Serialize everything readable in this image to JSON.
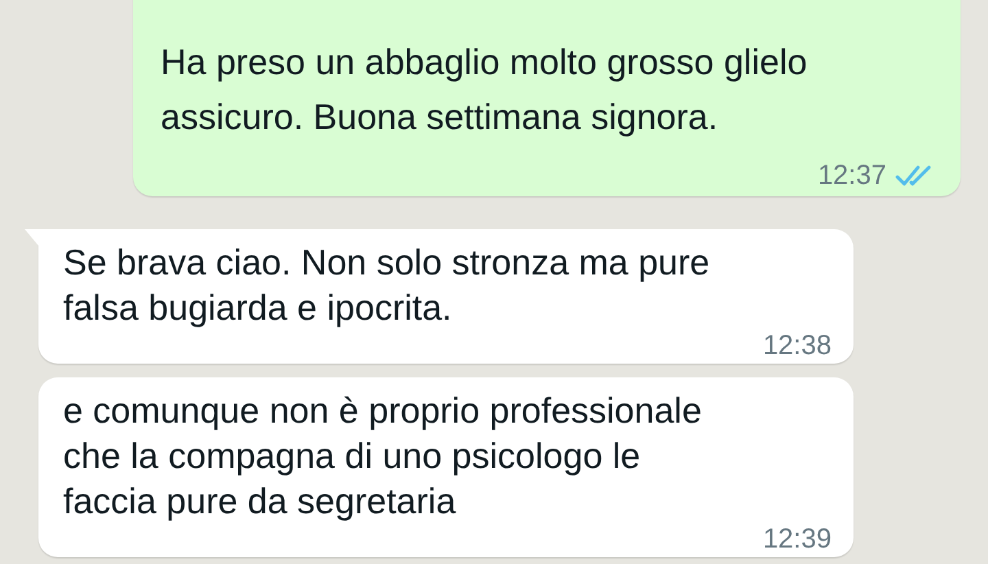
{
  "messages": [
    {
      "kind": "outgoing",
      "text": "Ha preso un abbaglio molto grosso glielo assicuro. Buona settimana signora.",
      "time": "12:37",
      "read": true
    },
    {
      "kind": "incoming",
      "text": "Se brava ciao. Non solo stronza ma pure falsa bugiarda e ipocrita.",
      "time": "12:38",
      "tail": true
    },
    {
      "kind": "incoming",
      "text": "e comunque non è proprio professionale che la compagna di uno psicologo le faccia pure da segretaria",
      "time": "12:39",
      "tail": false
    }
  ]
}
